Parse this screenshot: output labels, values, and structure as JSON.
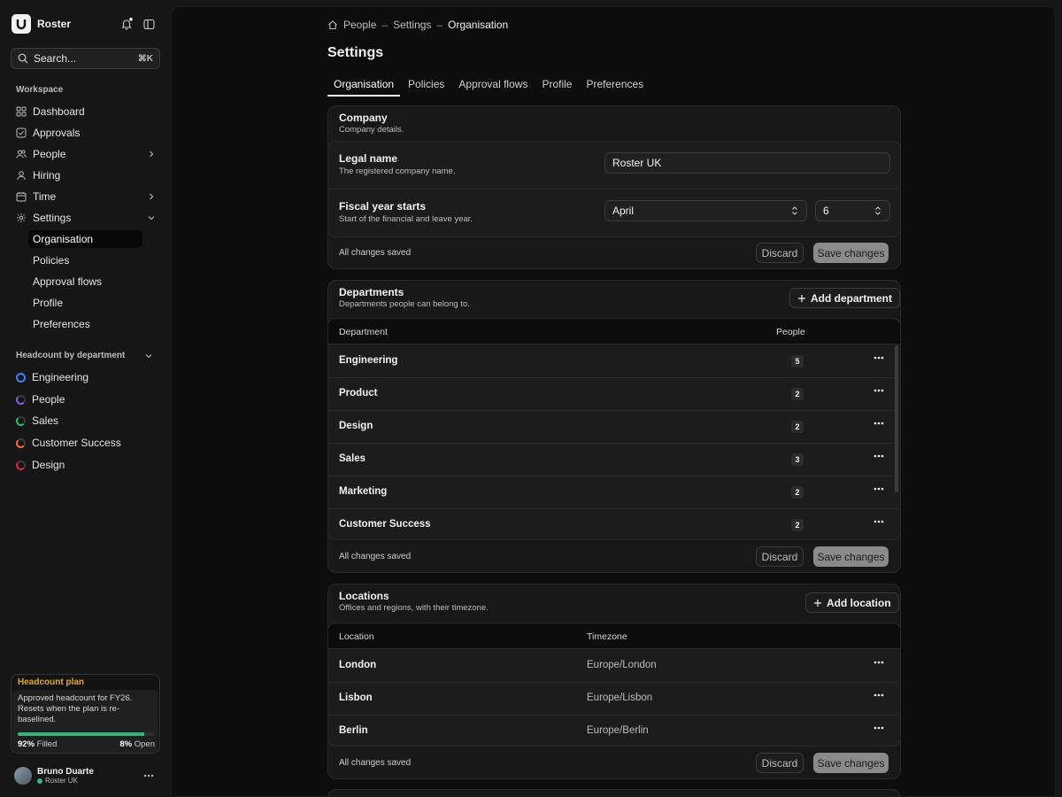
{
  "app": {
    "name": "Roster"
  },
  "search": {
    "placeholder": "Search...",
    "shortcut": "⌘K"
  },
  "sidebar": {
    "workspace_label": "Workspace",
    "items": [
      {
        "label": "Dashboard",
        "icon": "grid-icon"
      },
      {
        "label": "Approvals",
        "icon": "check-square-icon"
      },
      {
        "label": "People",
        "icon": "users-icon",
        "chevron": "right"
      },
      {
        "label": "Hiring",
        "icon": "user-icon"
      },
      {
        "label": "Time",
        "icon": "calendar-icon",
        "chevron": "right"
      },
      {
        "label": "Settings",
        "icon": "gear-icon",
        "chevron": "down"
      }
    ],
    "settings_sub": [
      "Organisation",
      "Policies",
      "Approval flows",
      "Profile",
      "Preferences"
    ],
    "headcount": {
      "label": "Headcount by department",
      "items": [
        {
          "label": "Engineering",
          "color": "#3b82f6"
        },
        {
          "label": "People",
          "color": "#8b5cf6"
        },
        {
          "label": "Sales",
          "color": "#22c55e"
        },
        {
          "label": "Customer Success",
          "color": "#f97316"
        },
        {
          "label": "Design",
          "color": "#e11d48"
        }
      ]
    },
    "plan": {
      "title": "Headcount plan",
      "description": "Approved headcount for FY26. Resets when the plan is re-baselined.",
      "filled_pct": "92%",
      "filled_label": "Filled",
      "open_pct": "8%",
      "open_label": "Open",
      "filled_fraction": 0.92
    },
    "user": {
      "name": "Bruno Duarte",
      "org": "Roster UK"
    }
  },
  "breadcrumb": [
    "People",
    "Settings",
    "Organisation"
  ],
  "page": {
    "title": "Settings"
  },
  "tabs": [
    "Organisation",
    "Policies",
    "Approval flows",
    "Profile",
    "Preferences"
  ],
  "company": {
    "title": "Company",
    "subtitle": "Company details.",
    "legal_name": {
      "label": "Legal name",
      "desc": "The registered company name.",
      "value": "Roster UK"
    },
    "fiscal": {
      "label": "Fiscal year starts",
      "desc": "Start of the financial and leave year.",
      "month": "April",
      "day": "6"
    },
    "status": "All changes saved",
    "discard": "Discard",
    "save": "Save changes"
  },
  "departments": {
    "title": "Departments",
    "subtitle": "Departments people can belong to.",
    "add": "Add department",
    "columns": [
      "Department",
      "People"
    ],
    "rows": [
      {
        "name": "Engineering",
        "people": "5"
      },
      {
        "name": "Product",
        "people": "2"
      },
      {
        "name": "Design",
        "people": "2"
      },
      {
        "name": "Sales",
        "people": "3"
      },
      {
        "name": "Marketing",
        "people": "2"
      },
      {
        "name": "Customer Success",
        "people": "2"
      }
    ],
    "status": "All changes saved",
    "discard": "Discard",
    "save": "Save changes"
  },
  "locations": {
    "title": "Locations",
    "subtitle": "Offices and regions, with their timezone.",
    "add": "Add location",
    "columns": [
      "Location",
      "Timezone"
    ],
    "rows": [
      {
        "name": "London",
        "tz": "Europe/London"
      },
      {
        "name": "Lisbon",
        "tz": "Europe/Lisbon"
      },
      {
        "name": "Berlin",
        "tz": "Europe/Berlin"
      }
    ],
    "status": "All changes saved",
    "discard": "Discard",
    "save": "Save changes"
  }
}
